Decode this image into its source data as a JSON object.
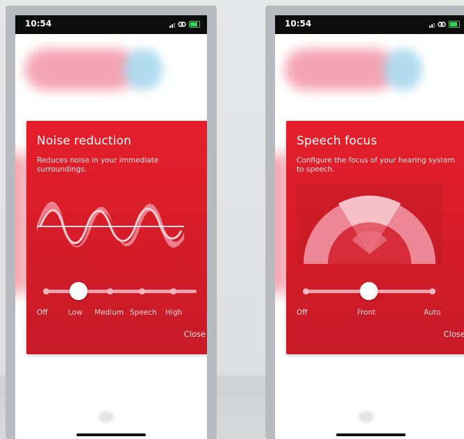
{
  "colors": {
    "card_red": "#e41f2b",
    "slider_track": "#f4a3ad",
    "status_bar": "#0d0d0d",
    "battery_green": "#36d25c"
  },
  "left_phone": {
    "status_time": "10:54",
    "status_icons": [
      "signal-icon",
      "link-icon",
      "battery-charging-icon"
    ],
    "card": {
      "title": "Noise reduction",
      "description": "Reduces noise in your immediate surroundings.",
      "visual": "noise-wave-icon",
      "slider": {
        "options": [
          "Off",
          "Low",
          "Medium",
          "Speech",
          "High"
        ],
        "selected": "Low"
      },
      "close_label": "Close"
    }
  },
  "right_phone": {
    "status_time": "10:54",
    "status_icons": [
      "signal-icon",
      "link-icon",
      "battery-charging-icon"
    ],
    "card": {
      "title": "Speech focus",
      "description": "Configure the focus of your hearing system to speech.",
      "visual": "speech-focus-fan-icon",
      "slider": {
        "options": [
          "Off",
          "Front",
          "Auto"
        ],
        "selected": "Front"
      },
      "close_label": "Close"
    }
  }
}
